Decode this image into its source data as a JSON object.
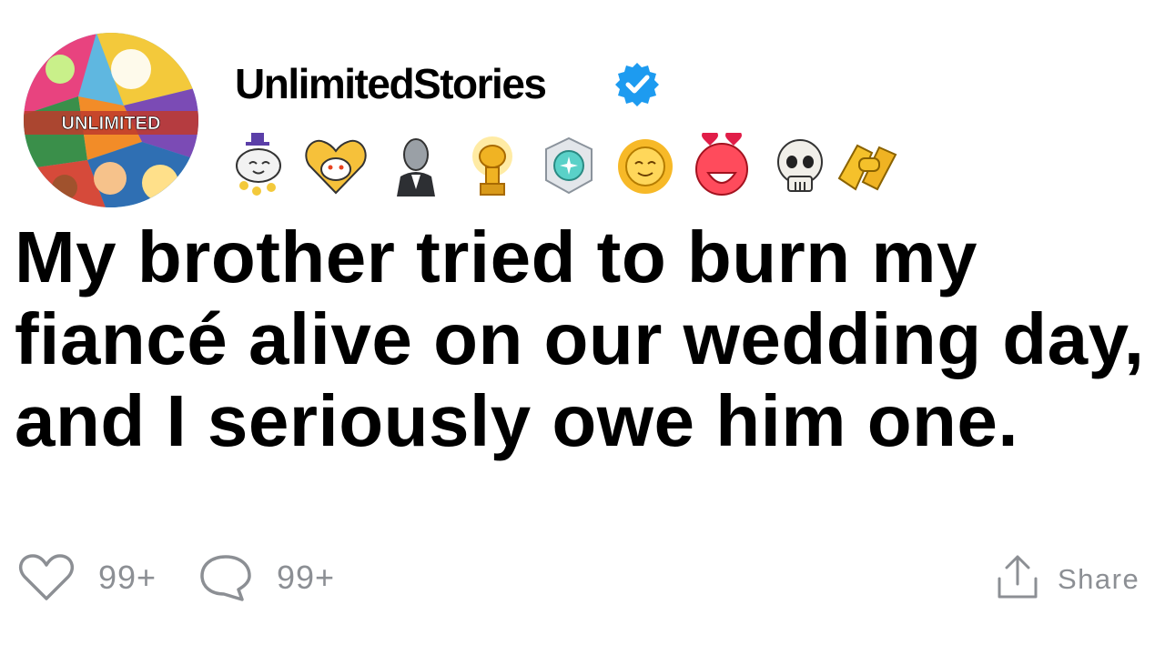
{
  "author": {
    "name": "UnlimitedStories",
    "avatar_text": "UNLIMITED",
    "verified_icon": "verified-badge-icon",
    "verified_color": "#1d9bf0"
  },
  "awards": [
    "wholesome-award-icon",
    "heartwarming-award-icon",
    "helpful-award-icon",
    "gold-award-icon",
    "platinum-award-icon",
    "sunny-award-icon",
    "hearteyes-award-icon",
    "skull-award-icon",
    "handshake-award-icon"
  ],
  "post": {
    "title": "My brother tried to burn my fiancé alive on our wedding day, and I seriously owe him one."
  },
  "actions": {
    "likes": "99+",
    "comments": "99+",
    "share_label": "Share"
  },
  "colors": {
    "text": "#000000",
    "muted": "#8c8f94"
  }
}
